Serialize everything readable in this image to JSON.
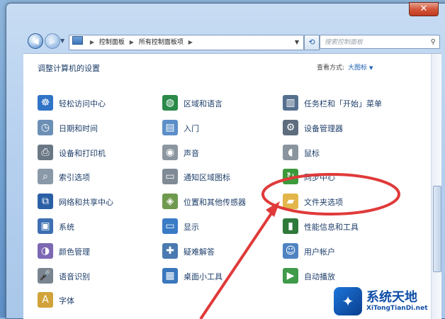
{
  "window": {
    "close_icon": "close-icon"
  },
  "navigation": {
    "breadcrumb": [
      "控制面板",
      "所有控制面板项"
    ],
    "search_placeholder": "搜索控制面板"
  },
  "header": {
    "title": "调整计算机的设置",
    "view_label": "查看方式:",
    "view_value": "大图标"
  },
  "columns": [
    [
      {
        "label": "轻松访问中心",
        "icon": "accessibility-icon",
        "color": "#2f74c6"
      },
      {
        "label": "日期和时间",
        "icon": "calendar-clock-icon",
        "color": "#6c8fb5"
      },
      {
        "label": "设备和打印机",
        "icon": "printer-icon",
        "color": "#6a7785"
      },
      {
        "label": "索引选项",
        "icon": "search-index-icon",
        "color": "#8a99a8"
      },
      {
        "label": "网络和共享中心",
        "icon": "network-icon",
        "color": "#2a5fa6"
      },
      {
        "label": "系统",
        "icon": "computer-icon",
        "color": "#3d6fb2"
      },
      {
        "label": "颜色管理",
        "icon": "color-management-icon",
        "color": "#7c68b3"
      },
      {
        "label": "语音识别",
        "icon": "microphone-icon",
        "color": "#7a8591"
      },
      {
        "label": "字体",
        "icon": "font-icon",
        "color": "#d1a33a"
      }
    ],
    [
      {
        "label": "区域和语言",
        "icon": "globe-icon",
        "color": "#2b8a4a"
      },
      {
        "label": "入门",
        "icon": "getting-started-icon",
        "color": "#5c8fc9"
      },
      {
        "label": "声音",
        "icon": "speaker-icon",
        "color": "#8c96a1"
      },
      {
        "label": "通知区域图标",
        "icon": "notification-area-icon",
        "color": "#7f8a96"
      },
      {
        "label": "位置和其他传感器",
        "icon": "sensor-icon",
        "color": "#6f9a4e"
      },
      {
        "label": "显示",
        "icon": "display-icon",
        "color": "#3a7bc6"
      },
      {
        "label": "疑难解答",
        "icon": "troubleshoot-icon",
        "color": "#4b7ab0"
      },
      {
        "label": "桌面小工具",
        "icon": "gadgets-icon",
        "color": "#3a77bd"
      }
    ],
    [
      {
        "label": "任务栏和「开始」菜单",
        "icon": "taskbar-icon",
        "color": "#56708f"
      },
      {
        "label": "设备管理器",
        "icon": "device-manager-icon",
        "color": "#5d6d7e"
      },
      {
        "label": "鼠标",
        "icon": "mouse-icon",
        "color": "#8a949e"
      },
      {
        "label": "同步中心",
        "icon": "sync-icon",
        "color": "#3c9a3c"
      },
      {
        "label": "文件夹选项",
        "icon": "folder-options-icon",
        "color": "#e2b64a"
      },
      {
        "label": "性能信息和工具",
        "icon": "performance-icon",
        "color": "#2f7a3a"
      },
      {
        "label": "用户帐户",
        "icon": "user-accounts-icon",
        "color": "#4f83c2"
      },
      {
        "label": "自动播放",
        "icon": "autoplay-icon",
        "color": "#3f9a4a"
      }
    ]
  ],
  "watermark": {
    "name": "系统天地",
    "domain": "XiTongTianDi.net"
  },
  "annotation": {
    "highlight_color": "#e03a3a"
  }
}
